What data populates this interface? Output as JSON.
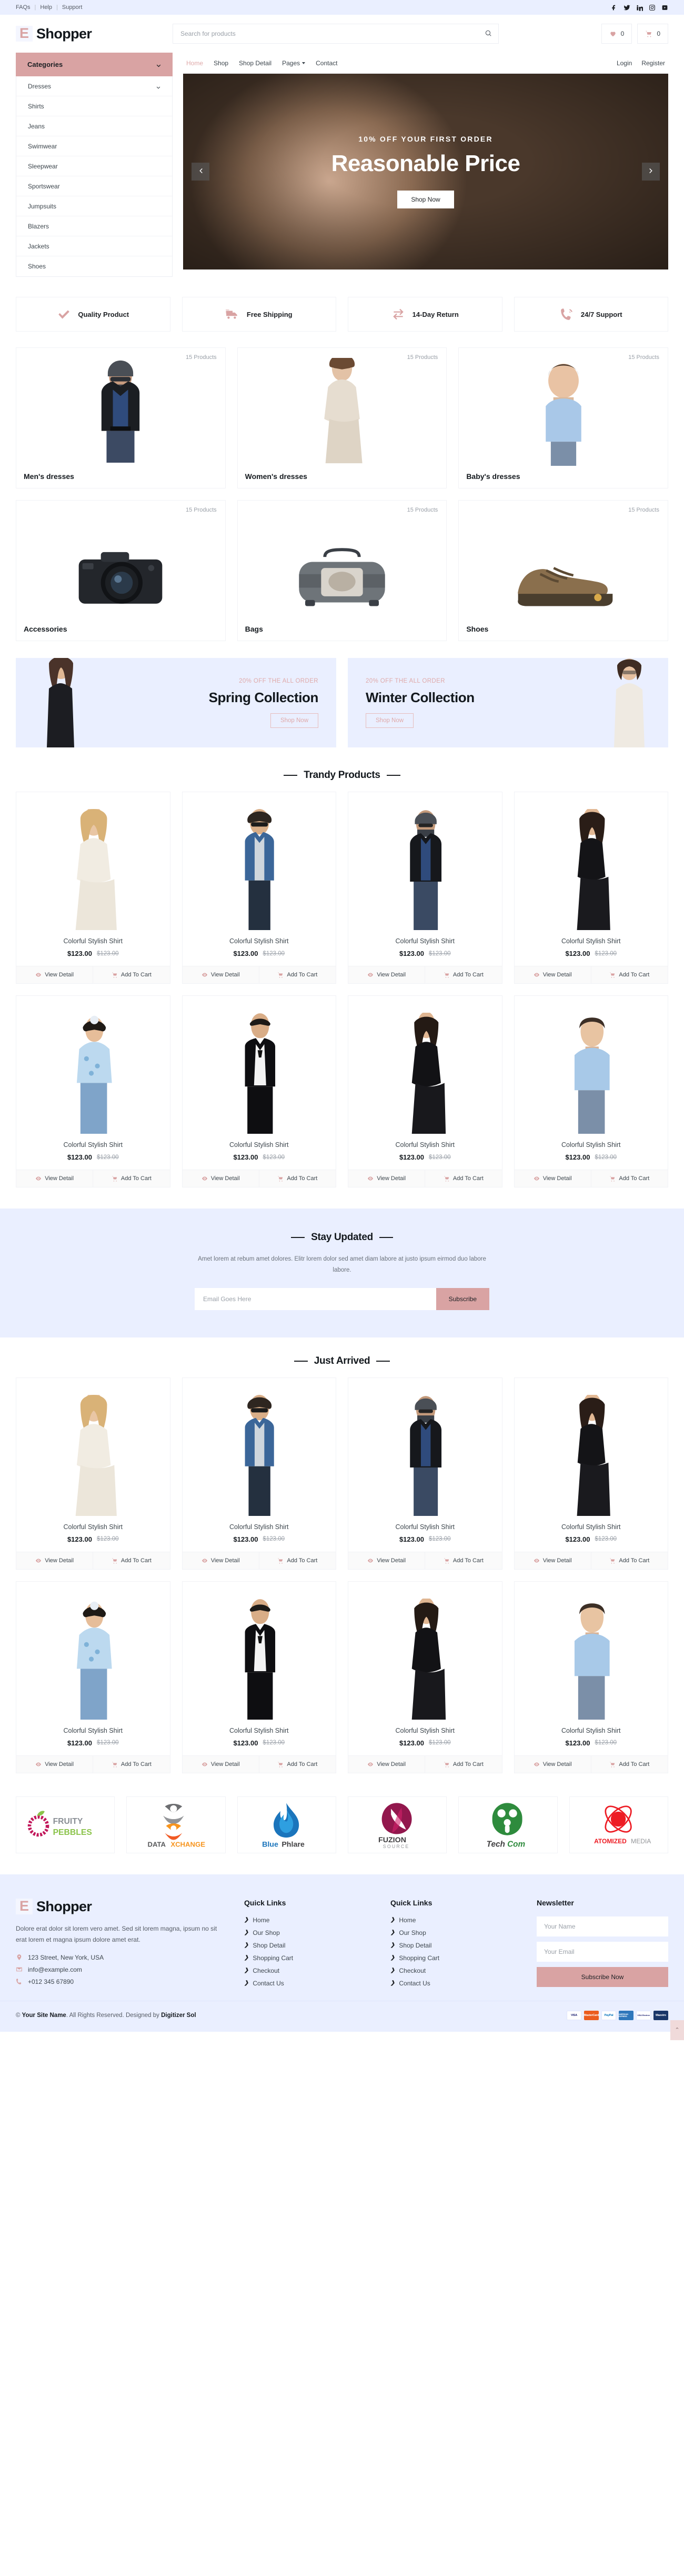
{
  "topbar": {
    "links": [
      "FAQs",
      "Help",
      "Support"
    ],
    "social": [
      "facebook-icon",
      "twitter-icon",
      "linkedin-icon",
      "instagram-icon",
      "youtube-icon"
    ]
  },
  "header": {
    "logo_mark": "E",
    "logo_text": "Shopper",
    "search_placeholder": "Search for products",
    "wishlist_count": "0",
    "cart_count": "0"
  },
  "categories": {
    "title": "Categories",
    "items": [
      "Dresses",
      "Shirts",
      "Jeans",
      "Swimwear",
      "Sleepwear",
      "Sportswear",
      "Jumpsuits",
      "Blazers",
      "Jackets",
      "Shoes"
    ]
  },
  "nav": {
    "items": [
      "Home",
      "Shop",
      "Shop Detail",
      "Pages",
      "Contact"
    ],
    "active": "Home",
    "dropdown": "Pages",
    "auth": [
      "Login",
      "Register"
    ]
  },
  "hero": {
    "kicker": "10% OFF YOUR FIRST ORDER",
    "title": "Reasonable Price",
    "button": "Shop Now"
  },
  "features": [
    {
      "label": "Quality Product",
      "icon": "check-icon"
    },
    {
      "label": "Free Shipping",
      "icon": "truck-icon"
    },
    {
      "label": "14-Day Return",
      "icon": "exchange-icon"
    },
    {
      "label": "24/7 Support",
      "icon": "phone-icon"
    }
  ],
  "category_cards": [
    {
      "name": "Men's dresses",
      "count": "15 Products"
    },
    {
      "name": "Women's dresses",
      "count": "15 Products"
    },
    {
      "name": "Baby's dresses",
      "count": "15 Products"
    },
    {
      "name": "Accessories",
      "count": "15 Products"
    },
    {
      "name": "Bags",
      "count": "15 Products"
    },
    {
      "name": "Shoes",
      "count": "15 Products"
    }
  ],
  "offers": [
    {
      "kicker": "20% OFF THE ALL ORDER",
      "title": "Spring Collection",
      "button": "Shop Now"
    },
    {
      "kicker": "20% OFF THE ALL ORDER",
      "title": "Winter Collection",
      "button": "Shop Now"
    }
  ],
  "trendy": {
    "title": "Trandy Products",
    "products": [
      {
        "name": "Colorful Stylish Shirt",
        "price": "$123.00",
        "old_price": "$123.00",
        "view": "View Detail",
        "cart": "Add To Cart"
      },
      {
        "name": "Colorful Stylish Shirt",
        "price": "$123.00",
        "old_price": "$123.00",
        "view": "View Detail",
        "cart": "Add To Cart"
      },
      {
        "name": "Colorful Stylish Shirt",
        "price": "$123.00",
        "old_price": "$123.00",
        "view": "View Detail",
        "cart": "Add To Cart"
      },
      {
        "name": "Colorful Stylish Shirt",
        "price": "$123.00",
        "old_price": "$123.00",
        "view": "View Detail",
        "cart": "Add To Cart"
      },
      {
        "name": "Colorful Stylish Shirt",
        "price": "$123.00",
        "old_price": "$123.00",
        "view": "View Detail",
        "cart": "Add To Cart"
      },
      {
        "name": "Colorful Stylish Shirt",
        "price": "$123.00",
        "old_price": "$123.00",
        "view": "View Detail",
        "cart": "Add To Cart"
      },
      {
        "name": "Colorful Stylish Shirt",
        "price": "$123.00",
        "old_price": "$123.00",
        "view": "View Detail",
        "cart": "Add To Cart"
      },
      {
        "name": "Colorful Stylish Shirt",
        "price": "$123.00",
        "old_price": "$123.00",
        "view": "View Detail",
        "cart": "Add To Cart"
      }
    ]
  },
  "stay": {
    "title": "Stay Updated",
    "description": "Amet lorem at rebum amet dolores. Elitr lorem dolor sed amet diam labore at justo ipsum eirmod duo labore labore.",
    "placeholder": "Email Goes Here",
    "button": "Subscribe"
  },
  "just_arrived": {
    "title": "Just Arrived",
    "products": [
      {
        "name": "Colorful Stylish Shirt",
        "price": "$123.00",
        "old_price": "$123.00",
        "view": "View Detail",
        "cart": "Add To Cart"
      },
      {
        "name": "Colorful Stylish Shirt",
        "price": "$123.00",
        "old_price": "$123.00",
        "view": "View Detail",
        "cart": "Add To Cart"
      },
      {
        "name": "Colorful Stylish Shirt",
        "price": "$123.00",
        "old_price": "$123.00",
        "view": "View Detail",
        "cart": "Add To Cart"
      },
      {
        "name": "Colorful Stylish Shirt",
        "price": "$123.00",
        "old_price": "$123.00",
        "view": "View Detail",
        "cart": "Add To Cart"
      },
      {
        "name": "Colorful Stylish Shirt",
        "price": "$123.00",
        "old_price": "$123.00",
        "view": "View Detail",
        "cart": "Add To Cart"
      },
      {
        "name": "Colorful Stylish Shirt",
        "price": "$123.00",
        "old_price": "$123.00",
        "view": "View Detail",
        "cart": "Add To Cart"
      },
      {
        "name": "Colorful Stylish Shirt",
        "price": "$123.00",
        "old_price": "$123.00",
        "view": "View Detail",
        "cart": "Add To Cart"
      },
      {
        "name": "Colorful Stylish Shirt",
        "price": "$123.00",
        "old_price": "$123.00",
        "view": "View Detail",
        "cart": "Add To Cart"
      }
    ]
  },
  "vendors": [
    {
      "name": "FRUITY PEBBLES"
    },
    {
      "name": "DATAXCHANGE"
    },
    {
      "name": "BluePhlare"
    },
    {
      "name": "FUZION SOURCE"
    },
    {
      "name": "TechCom"
    },
    {
      "name": "ATOMIZED MEDIA"
    }
  ],
  "footer": {
    "logo_mark": "E",
    "logo_text": "Shopper",
    "description": "Dolore erat dolor sit lorem vero amet. Sed sit lorem magna, ipsum no sit erat lorem et magna ipsum dolore amet erat.",
    "address": "123 Street, New York, USA",
    "email": "info@example.com",
    "phone": "+012 345 67890",
    "quick_links_title": "Quick Links",
    "quick_links": [
      "Home",
      "Our Shop",
      "Shop Detail",
      "Shopping Cart",
      "Checkout",
      "Contact Us"
    ],
    "quick_links_title_2": "Quick Links",
    "quick_links_2": [
      "Home",
      "Our Shop",
      "Shop Detail",
      "Shopping Cart",
      "Checkout",
      "Contact Us"
    ],
    "newsletter_title": "Newsletter",
    "name_placeholder": "Your Name",
    "email_placeholder": "Your Email",
    "subscribe_button": "Subscribe Now"
  },
  "copyright": {
    "prefix": "© ",
    "site": "Your Site Name",
    "middle": ". All Rights Reserved. Designed by ",
    "designer": "Digitizer Sol",
    "cards": [
      {
        "label": "VISA",
        "bg": "#ffffff",
        "fg": "#1a1f71"
      },
      {
        "label": "MasterCard",
        "bg": "#eb5c1e",
        "fg": "#ffffff"
      },
      {
        "label": "PayPal",
        "bg": "#ffffff",
        "fg": "#0070ba"
      },
      {
        "label": "AMERICAN EXPRESS",
        "bg": "#2e77bb",
        "fg": "#ffffff"
      },
      {
        "label": "VISA Electron",
        "bg": "#ffffff",
        "fg": "#1a1f71"
      },
      {
        "label": "Maestro",
        "bg": "#1a3668",
        "fg": "#ffffff"
      }
    ],
    "to_top": "⌃"
  }
}
